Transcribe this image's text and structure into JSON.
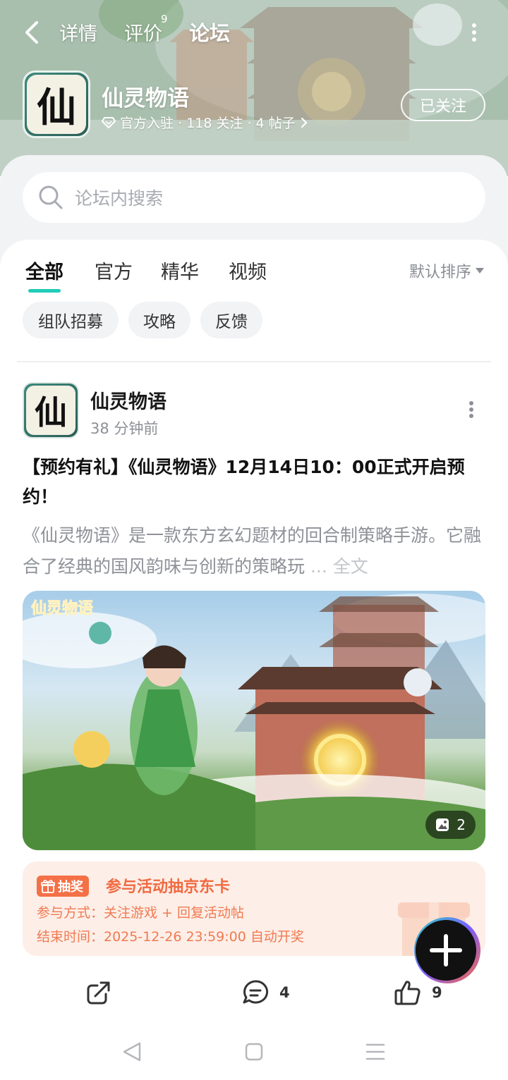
{
  "nav": {
    "tabs": [
      "详情",
      "评价",
      "论坛"
    ],
    "review_badge": "9",
    "active_tab": "论坛"
  },
  "app": {
    "logo_char": "仙",
    "name": "仙灵物语",
    "meta": "官方入驻 · 118 关注 · 4 帖子",
    "follow_label": "已关注"
  },
  "search": {
    "placeholder": "论坛内搜索"
  },
  "tabs": [
    "全部",
    "官方",
    "精华",
    "视频"
  ],
  "sort_label": "默认排序",
  "chips": [
    "组队招募",
    "攻略",
    "反馈"
  ],
  "post": {
    "author": "仙灵物语",
    "time": "38 分钟前",
    "title": "【预约有礼】《仙灵物语》12月14日10：00正式开启预约！",
    "excerpt": "《仙灵物语》是一款东方玄幻题材的回合制策略手游。它融合了经典的国风韵味与创新的策略玩",
    "ellipsis": " ... ",
    "full_text": "全文",
    "image_count": "2",
    "image_logo_text": "仙灵物语",
    "lottery": {
      "badge": "抽奖",
      "title": "参与活动抽京东卡",
      "method": "参与方式：关注游戏 + 回复活动帖",
      "end_time": "结束时间：2025-12-26 23:59:00 自动开奖"
    },
    "comments": "4",
    "likes": "9"
  },
  "colors": {
    "accent": "#22cbb8",
    "lottery_orange": "#f06a40",
    "lottery_bg": "#fdeee7"
  }
}
